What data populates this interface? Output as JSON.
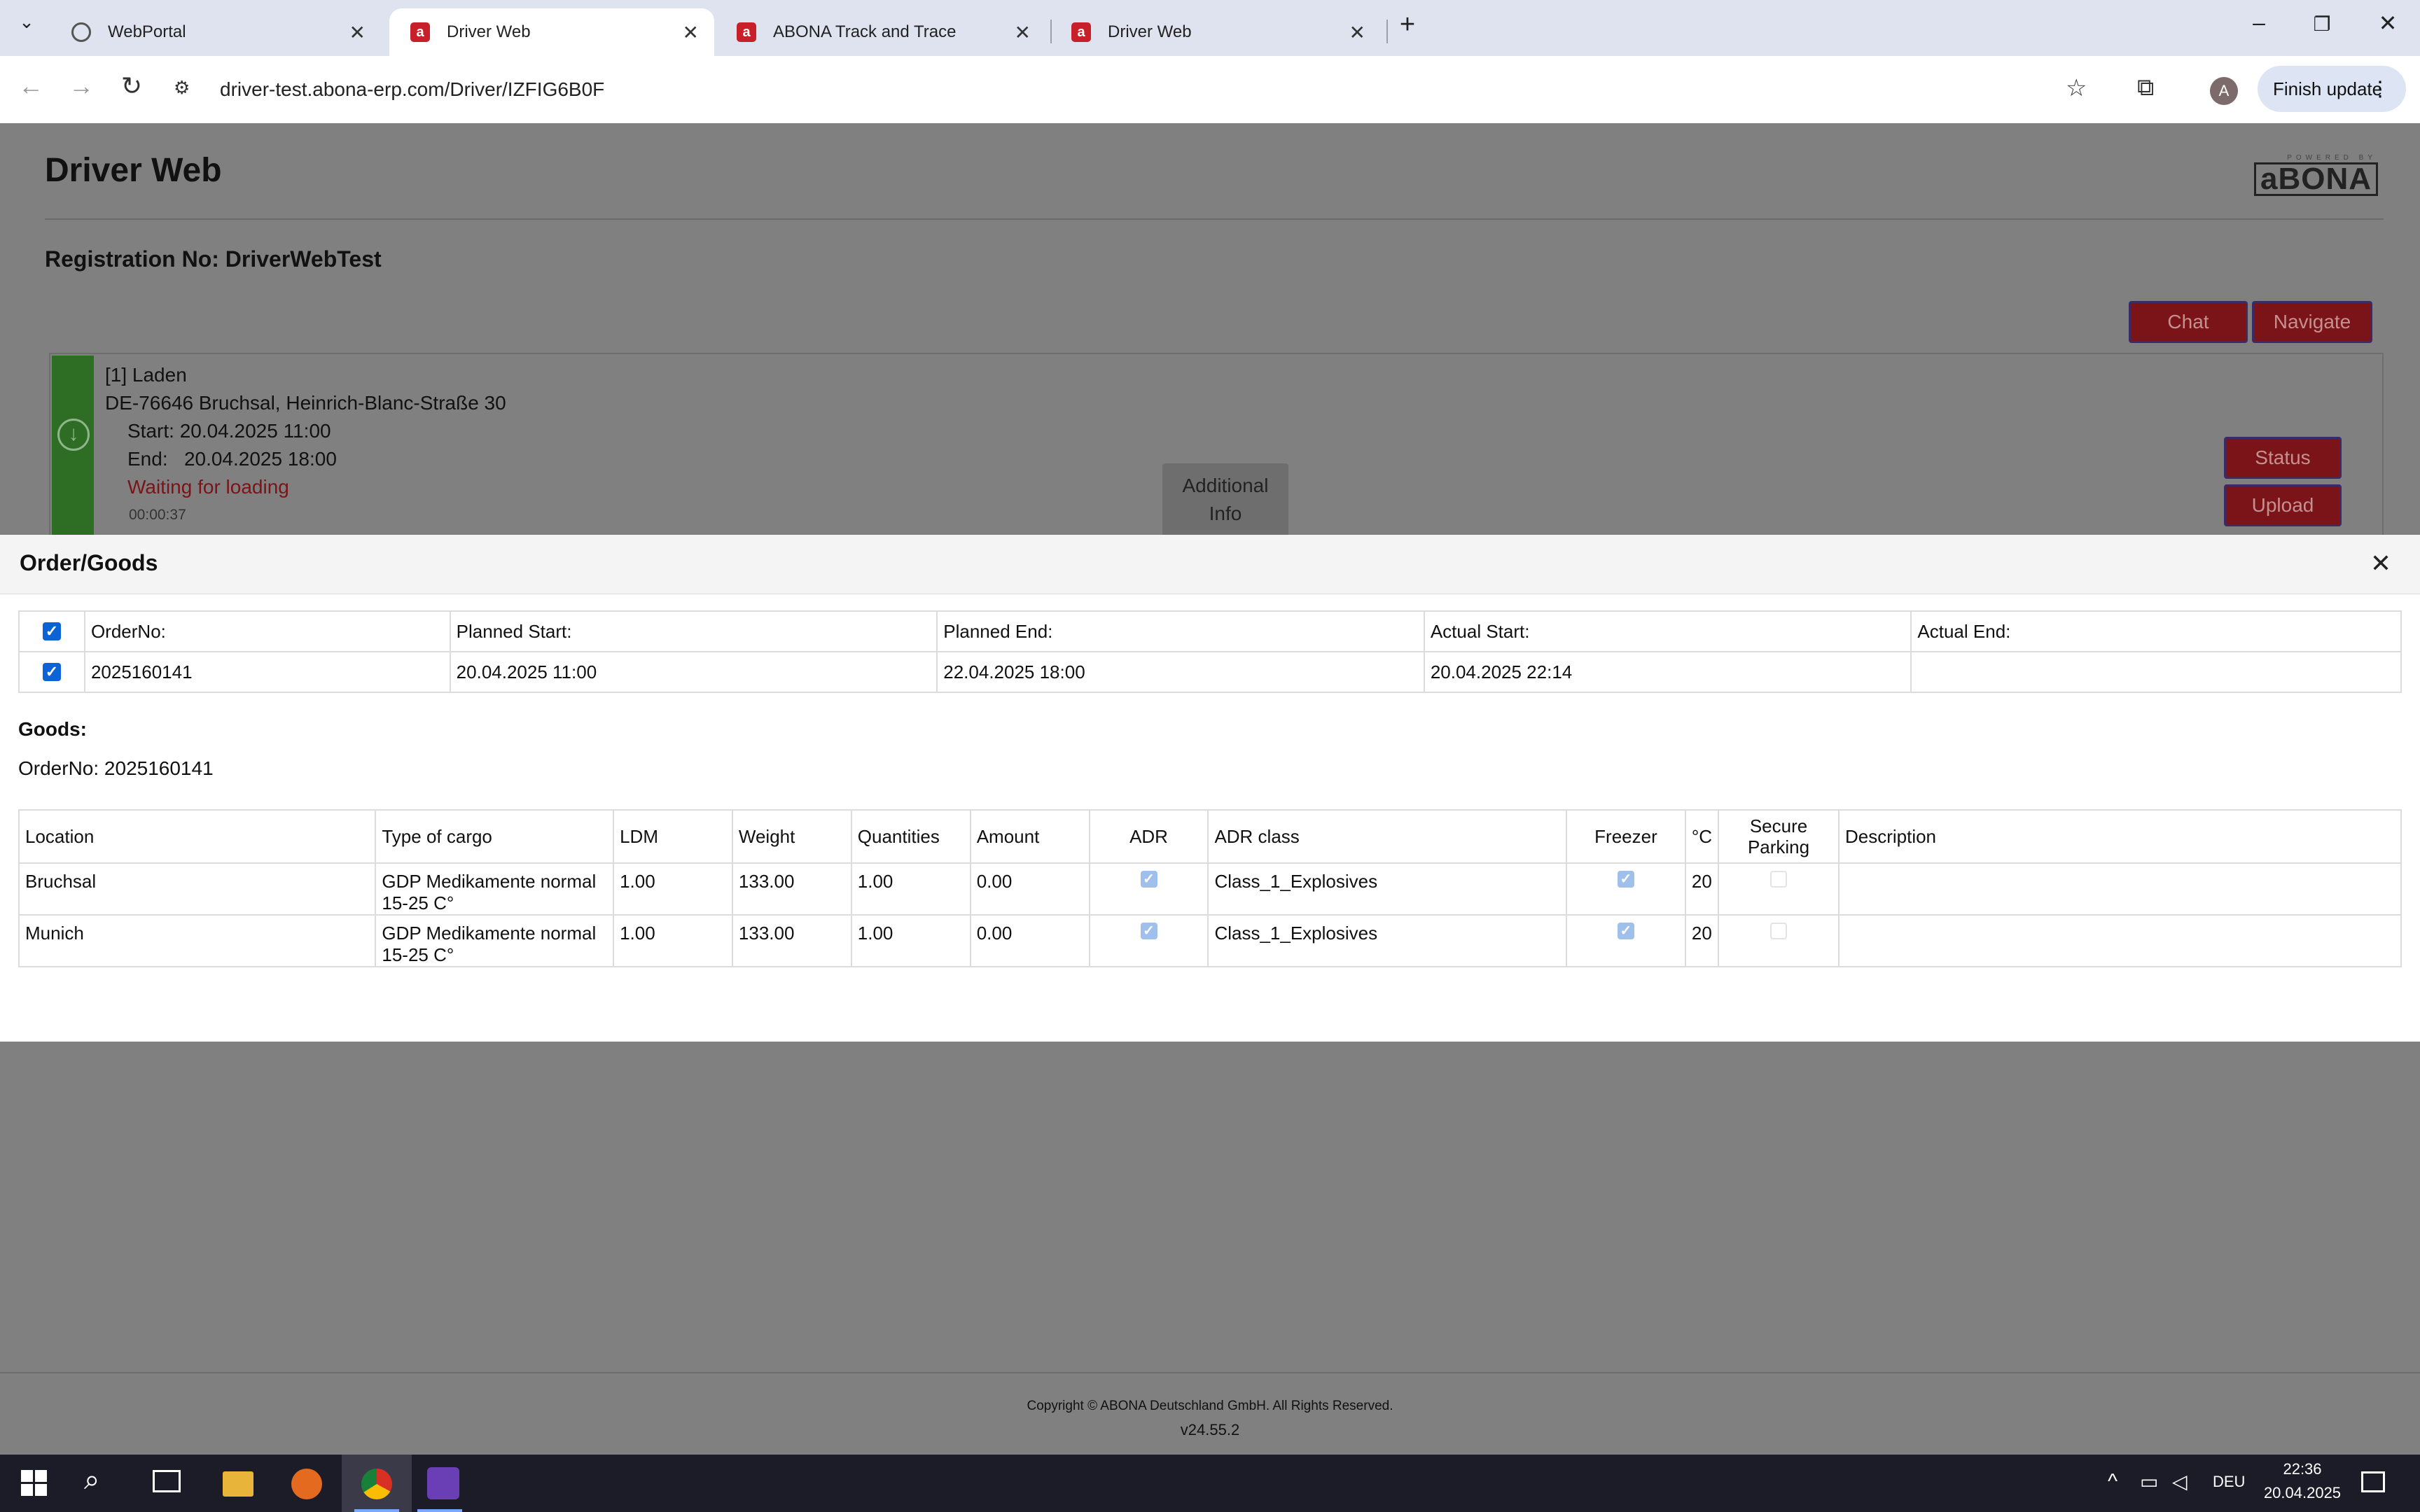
{
  "browser": {
    "tabs": [
      {
        "title": "WebPortal",
        "favicon": "globe-icon"
      },
      {
        "title": "Driver Web",
        "favicon": "abona-icon",
        "active": true
      },
      {
        "title": "ABONA Track and Trace",
        "favicon": "abona-icon"
      },
      {
        "title": "Driver Web",
        "favicon": "abona-icon"
      }
    ],
    "url": "driver-test.abona-erp.com/Driver/IZFIG6B0F",
    "finish_update": "Finish update",
    "avatar": "A"
  },
  "page": {
    "title": "Driver Web",
    "logo_small": "POWERED BY",
    "logo_text": "aBONA",
    "registration": "Registration No: DriverWebTest",
    "chat_button": "Chat",
    "navigate_button": "Navigate",
    "stop": {
      "heading": "[1] Laden",
      "address": "DE-76646 Bruchsal, Heinrich-Blanc-Straße 30",
      "start": "Start: 20.04.2025 11:00",
      "end": "End:   20.04.2025 18:00",
      "status": "Waiting for loading",
      "timer": "00:00:37",
      "additional_info_1": "Additional",
      "additional_info_2": "Info",
      "status_button": "Status",
      "upload_button": "Upload"
    },
    "copyright": "Copyright © ABONA Deutschland GmbH. All Rights Reserved.",
    "version": "v24.55.2"
  },
  "modal": {
    "title": "Order/Goods",
    "order_table": {
      "headers": [
        "OrderNo:",
        "Planned Start:",
        "Planned End:",
        "Actual Start:",
        "Actual End:"
      ],
      "row": [
        "2025160141",
        "20.04.2025 11:00",
        "22.04.2025 18:00",
        "20.04.2025 22:14",
        ""
      ]
    },
    "goods_label": "Goods:",
    "goods_order": "OrderNo: 2025160141",
    "goods_table": {
      "headers": [
        "Location",
        "Type of cargo",
        "LDM",
        "Weight",
        "Quantities",
        "Amount",
        "ADR",
        "ADR class",
        "Freezer",
        "°C",
        "Secure Parking",
        "Description"
      ],
      "rows": [
        {
          "location": "Bruchsal",
          "cargo": "GDP Medikamente normal 15-25 C°",
          "ldm": "1.00",
          "weight": "133.00",
          "quantities": "1.00",
          "amount": "0.00",
          "adr": true,
          "adr_class": "Class_1_Explosives",
          "freezer": true,
          "temp": "20",
          "secure_parking": false,
          "description": ""
        },
        {
          "location": "Munich",
          "cargo": "GDP Medikamente normal 15-25 C°",
          "ldm": "1.00",
          "weight": "133.00",
          "quantities": "1.00",
          "amount": "0.00",
          "adr": true,
          "adr_class": "Class_1_Explosives",
          "freezer": true,
          "temp": "20",
          "secure_parking": false,
          "description": ""
        }
      ]
    }
  },
  "taskbar": {
    "language": "DEU",
    "time": "22:36",
    "date": "20.04.2025"
  },
  "colors": {
    "accent_red": "#c8202b",
    "checkbox_blue": "#0b63d6",
    "stop_green": "#2d6d24"
  }
}
